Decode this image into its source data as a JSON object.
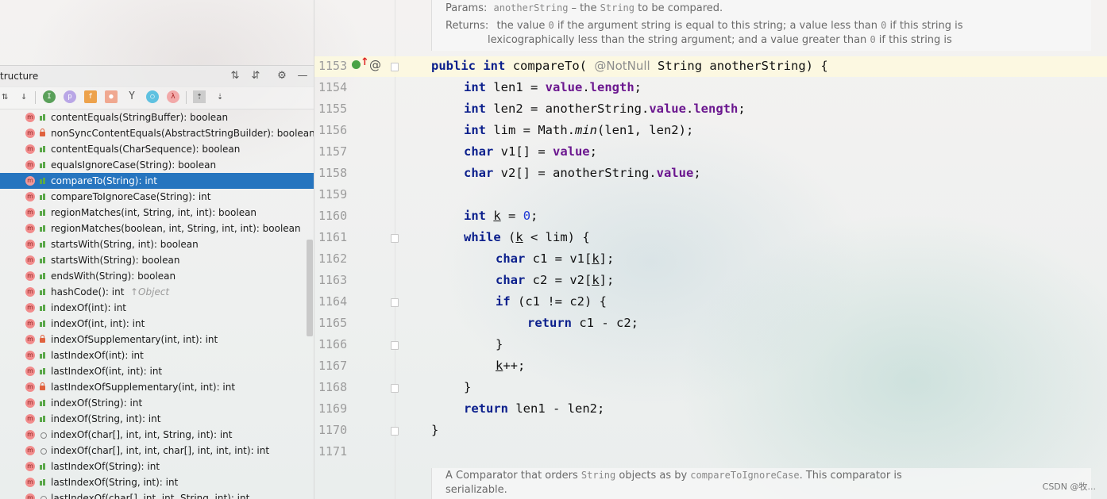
{
  "structure": {
    "title": "tructure",
    "toolbar_icons": [
      "sort-visibility-icon",
      "sort-alpha-icon",
      "show-inherited-icon",
      "show-properties-icon",
      "show-fields-icon",
      "show-non-public-icon",
      "show-lambdas-icon",
      "show-anonymous-icon",
      "show-lambda-icon",
      "autoscroll-to-source-icon",
      "autoscroll-from-source-icon"
    ],
    "members": [
      {
        "label": "contentEquals(StringBuffer): boolean",
        "visibility": "public",
        "selected": false
      },
      {
        "label": "nonSyncContentEquals(AbstractStringBuilder): boolean",
        "visibility": "private",
        "selected": false
      },
      {
        "label": "contentEquals(CharSequence): boolean",
        "visibility": "public",
        "selected": false
      },
      {
        "label": "equalsIgnoreCase(String): boolean",
        "visibility": "public",
        "selected": false
      },
      {
        "label": "compareTo(String): int",
        "visibility": "public",
        "selected": true
      },
      {
        "label": "compareToIgnoreCase(String): int",
        "visibility": "public",
        "selected": false
      },
      {
        "label": "regionMatches(int, String, int, int): boolean",
        "visibility": "public",
        "selected": false
      },
      {
        "label": "regionMatches(boolean, int, String, int, int): boolean",
        "visibility": "public",
        "selected": false
      },
      {
        "label": "startsWith(String, int): boolean",
        "visibility": "public",
        "selected": false
      },
      {
        "label": "startsWith(String): boolean",
        "visibility": "public",
        "selected": false
      },
      {
        "label": "endsWith(String): boolean",
        "visibility": "public",
        "selected": false
      },
      {
        "label": "hashCode(): int",
        "hint": "↑Object",
        "visibility": "public",
        "selected": false
      },
      {
        "label": "indexOf(int): int",
        "visibility": "public",
        "selected": false
      },
      {
        "label": "indexOf(int, int): int",
        "visibility": "public",
        "selected": false
      },
      {
        "label": "indexOfSupplementary(int, int): int",
        "visibility": "private",
        "selected": false
      },
      {
        "label": "lastIndexOf(int): int",
        "visibility": "public",
        "selected": false
      },
      {
        "label": "lastIndexOf(int, int): int",
        "visibility": "public",
        "selected": false
      },
      {
        "label": "lastIndexOfSupplementary(int, int): int",
        "visibility": "private",
        "selected": false
      },
      {
        "label": "indexOf(String): int",
        "visibility": "public",
        "selected": false
      },
      {
        "label": "indexOf(String, int): int",
        "visibility": "public",
        "selected": false
      },
      {
        "label": "indexOf(char[], int, int, String, int): int",
        "visibility": "package",
        "selected": false
      },
      {
        "label": "indexOf(char[], int, int, char[], int, int, int): int",
        "visibility": "package",
        "selected": false
      },
      {
        "label": "lastIndexOf(String): int",
        "visibility": "public",
        "selected": false
      },
      {
        "label": "lastIndexOf(String, int): int",
        "visibility": "public",
        "selected": false
      },
      {
        "label": "lastIndexOf(char[], int, int, String, int): int",
        "visibility": "package",
        "selected": false
      }
    ]
  },
  "doc_top": {
    "params_label": "Params:",
    "params_code": "anotherString",
    "params_dash": " – the ",
    "params_type": "String",
    "params_tail": " to be compared.",
    "returns_label": "Returns:",
    "returns_a": "the value ",
    "returns_zero1": "0",
    "returns_b": " if the argument string is equal to this string; a value less than ",
    "returns_zero2": "0",
    "returns_c": " if this string is",
    "returns_line2a": "lexicographically less than the string argument; and a value greater than ",
    "returns_zero3": "0",
    "returns_line2b": " if this string is"
  },
  "doc_bottom": {
    "text_a": "A Comparator that orders ",
    "code_a": "String",
    "text_b": " objects as by ",
    "code_b": "compareToIgnoreCase",
    "text_c": ". This comparator is",
    "text_d": "serializable."
  },
  "editor": {
    "line_numbers": [
      "1153",
      "1154",
      "1155",
      "1156",
      "1157",
      "1158",
      "1159",
      "1160",
      "1161",
      "1162",
      "1163",
      "1164",
      "1165",
      "1166",
      "1167",
      "1168",
      "1169",
      "1170",
      "1171"
    ],
    "tokens": {
      "public": "public",
      "int": "int",
      "char": "char",
      "while": "while",
      "if": "if",
      "return": "return",
      "compareTo": "compareTo(",
      "notnull": "@NotNull",
      "sig_tail": " String anotherString) {",
      "len1_decl": " len1 = ",
      "value": "value",
      "dot": ".",
      "length": "length",
      "semi": ";",
      "len2_decl": " len2 = anotherString.",
      "lim_decl": " lim = Math.",
      "min": "min",
      "min_args": "(len1, len2);",
      "v1_decl": " v1[] = ",
      "v2_decl": " v2[] = anotherString.",
      "k": "k",
      "k_assign": " = ",
      "zero": "0",
      "while_open": " (",
      "while_tail": " < lim) {",
      "c1_decl": " c1 = v1[",
      "c2_decl": " c2 = v2[",
      "close_idx": "];",
      "if_cond": " (c1 != c2) {",
      "ret_c": " c1 - c2;",
      "rbrace": "}",
      "kpp": "++;",
      "ret_len": " len1 - len2;"
    }
  },
  "watermark": "CSDN @牧..."
}
